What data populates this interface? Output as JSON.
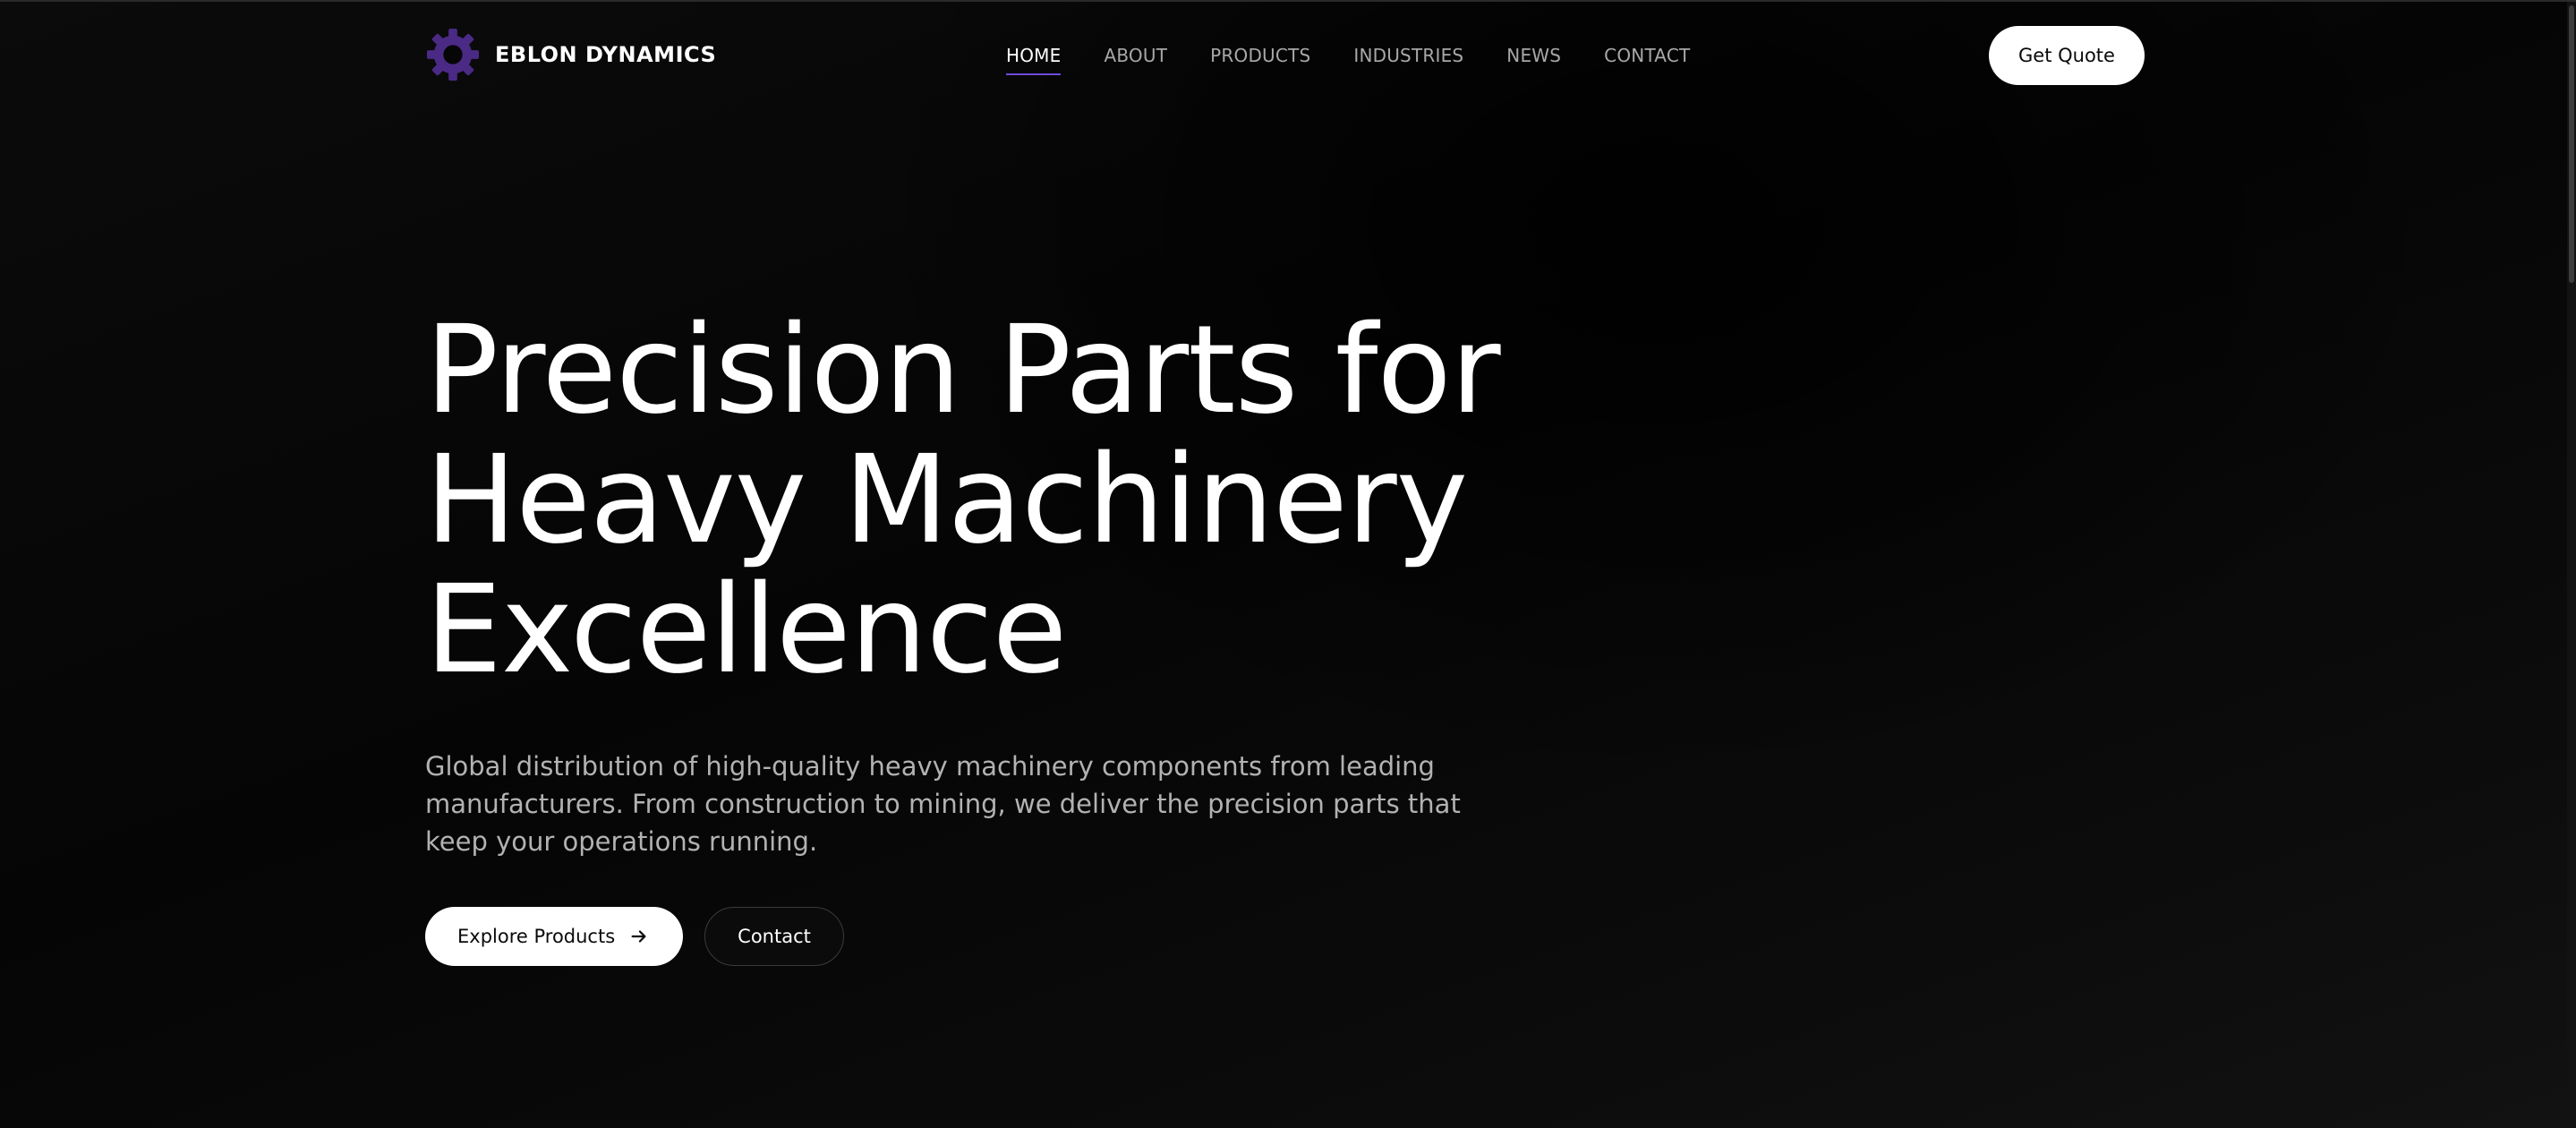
{
  "brand": {
    "name": "EBLON DYNAMICS",
    "logo_icon": "gear-icon",
    "logo_color": "#4a2a85"
  },
  "nav": {
    "items": [
      {
        "label": "HOME",
        "active": true
      },
      {
        "label": "ABOUT",
        "active": false
      },
      {
        "label": "PRODUCTS",
        "active": false
      },
      {
        "label": "INDUSTRIES",
        "active": false
      },
      {
        "label": "NEWS",
        "active": false
      },
      {
        "label": "CONTACT",
        "active": false
      }
    ],
    "active_underline_color": "#6f4bd8"
  },
  "header": {
    "cta_label": "Get Quote"
  },
  "hero": {
    "title_lines": [
      "Precision Parts for",
      "Heavy Machinery",
      "Excellence"
    ],
    "description": "Global distribution of high-quality heavy machinery components from leading manufacturers. From construction to mining, we deliver the precision parts that keep your operations running.",
    "primary_button": {
      "label": "Explore Products",
      "icon": "arrow-right-icon"
    },
    "secondary_button": {
      "label": "Contact"
    }
  },
  "colors": {
    "background": "#060606",
    "text_primary": "#ffffff",
    "text_muted": "#b2b2b2",
    "accent": "#6f4bd8"
  }
}
